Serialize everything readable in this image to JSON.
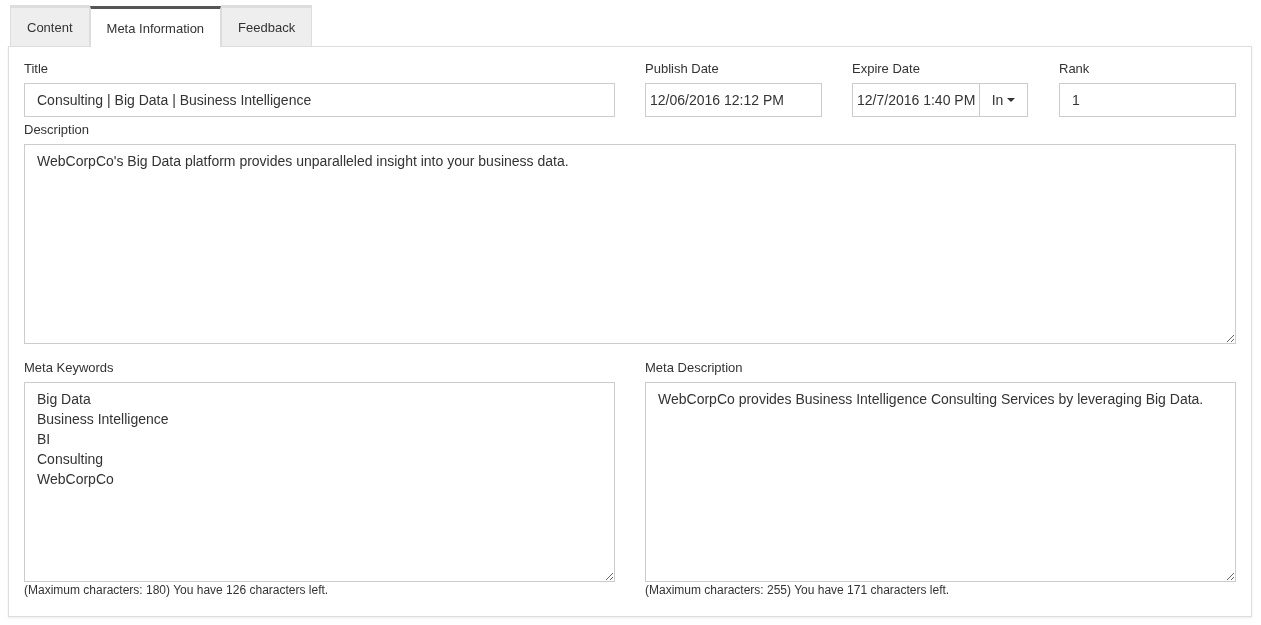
{
  "tabs": [
    {
      "label": "Content",
      "selected": false
    },
    {
      "label": "Meta Information",
      "selected": true
    },
    {
      "label": "Feedback",
      "selected": false
    }
  ],
  "title": {
    "label": "Title",
    "value": "Consulting | Big Data | Business Intelligence"
  },
  "publish_date": {
    "label": "Publish Date",
    "value": "12/06/2016 12:12 PM"
  },
  "expire_date": {
    "label": "Expire Date",
    "value": "12/7/2016 1:40 PM",
    "dropdown": "In"
  },
  "rank": {
    "label": "Rank",
    "value": "1"
  },
  "description": {
    "label": "Description",
    "value": "WebCorpCo's Big Data platform provides unparalleled insight into your business data."
  },
  "meta_keywords": {
    "label": "Meta Keywords",
    "value": "Big Data\nBusiness Intelligence\nBI\nConsulting\nWebCorpCo",
    "help": "(Maximum characters: 180) You have 126 characters left."
  },
  "meta_description": {
    "label": "Meta Description",
    "value": "WebCorpCo provides Business Intelligence Consulting Services by leveraging Big Data.",
    "help": "(Maximum characters: 255) You have 171 characters left."
  }
}
